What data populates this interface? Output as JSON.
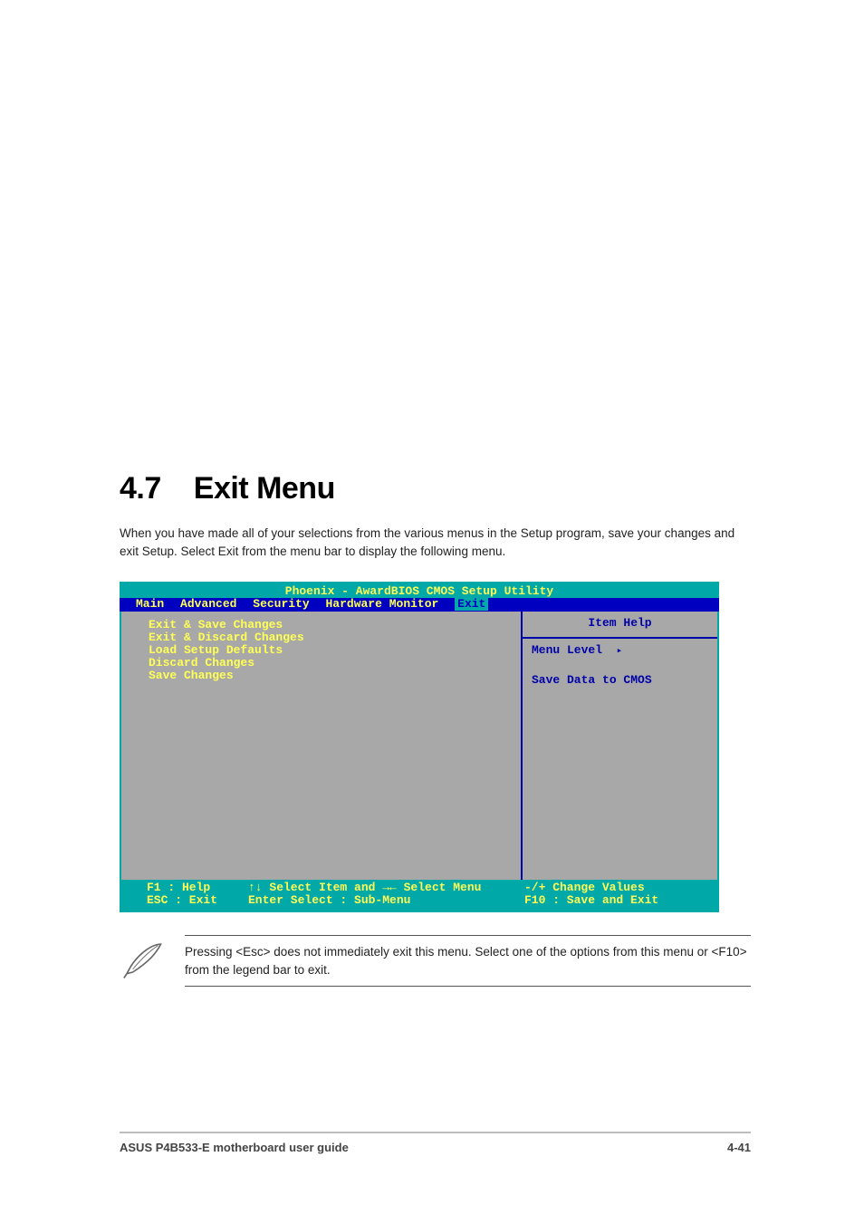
{
  "heading": {
    "number": "4.7",
    "title": "Exit Menu"
  },
  "intro": "When you have made all of your selections from the various menus in the Setup program, save your changes and exit Setup. Select Exit from the menu bar to display the following menu.",
  "bios": {
    "title": "Phoenix - AwardBIOS CMOS Setup Utility",
    "tabs": [
      "Main",
      "Advanced",
      "Security",
      "Hardware Monitor",
      "Exit"
    ],
    "active_tab_index": 4,
    "items": [
      "Exit & Save Changes",
      "Exit & Discard Changes",
      "Load Setup Defaults",
      "Discard Changes",
      "Save Changes"
    ],
    "help": {
      "title": "Item Help",
      "menu_level_label": "Menu Level",
      "text": "Save Data to CMOS"
    },
    "footer": {
      "row1": {
        "c1": "F1  : Help",
        "c2": "↑↓ Select Item and →← Select Menu",
        "c3": "-/+ Change Values"
      },
      "row2": {
        "c1": "ESC : Exit",
        "c2": "Enter Select : Sub-Menu",
        "c3": "F10 : Save and Exit"
      }
    }
  },
  "note": "Pressing <Esc> does not immediately exit this menu. Select one of the options from this menu or <F10> from the legend bar to exit.",
  "footer": {
    "left": "ASUS P4B533-E motherboard user guide",
    "right": "4-41"
  }
}
